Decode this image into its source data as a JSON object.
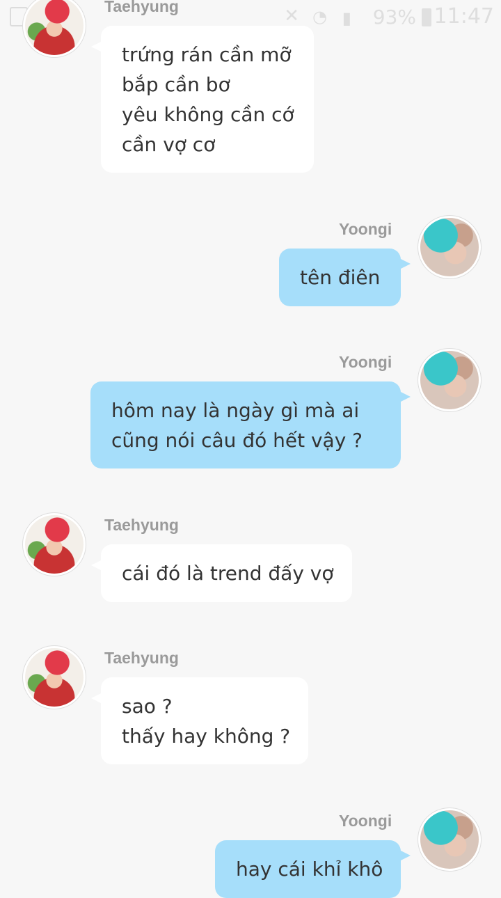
{
  "status_bar": {
    "battery": "93%",
    "time": "11:47"
  },
  "messages": [
    {
      "sender": "Taehyung",
      "side": "in",
      "lines": [
        "trứng rán cần mỡ",
        "bắp cần bơ",
        "yêu không cần cớ",
        "cần vợ cơ"
      ]
    },
    {
      "sender": "Yoongi",
      "side": "out",
      "lines": [
        "tên điên"
      ]
    },
    {
      "sender": "Yoongi",
      "side": "out",
      "lines": [
        "hôm nay là ngày gì mà ai",
        "cũng nói câu đó hết vậy ?"
      ]
    },
    {
      "sender": "Taehyung",
      "side": "in",
      "lines": [
        "cái đó là trend đấy vợ"
      ]
    },
    {
      "sender": "Taehyung",
      "side": "in",
      "lines": [
        "sao ?",
        "thấy hay không ?"
      ]
    },
    {
      "sender": "Yoongi",
      "side": "out",
      "lines": [
        "hay cái khỉ khô"
      ]
    }
  ]
}
